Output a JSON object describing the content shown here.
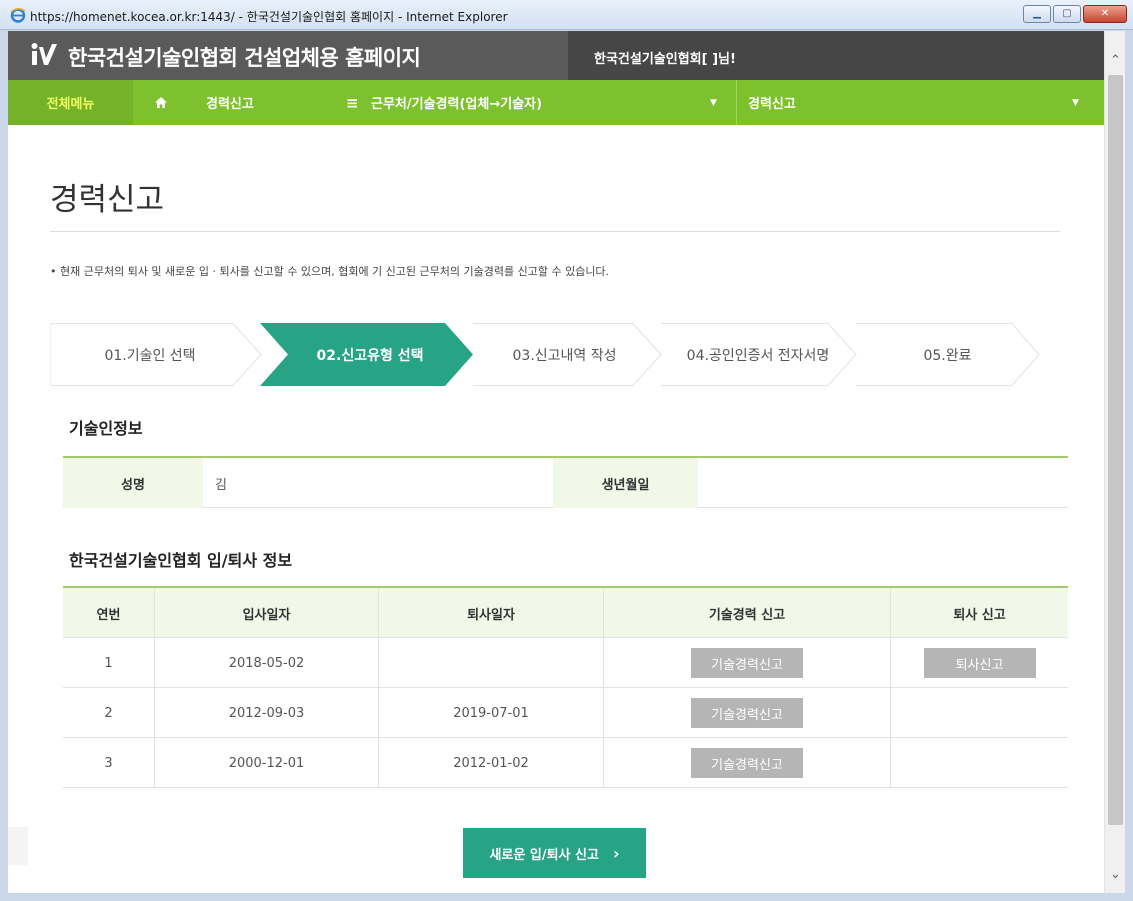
{
  "window": {
    "title": "https://homenet.kocea.or.kr:1443/ - 한국건설기술인협회 홈페이지 - Internet Explorer"
  },
  "header": {
    "site_title": "한국건설기술인협회 건설업체용 홈페이지",
    "user_greeting": "한국건설기술인협회[        ]님!"
  },
  "nav": {
    "all_menu": "전체메뉴",
    "section": "경력신고",
    "submenu": "근무처/기술경력(업체→기술자)",
    "current": "경력신고"
  },
  "page": {
    "title": "경력신고",
    "description": "• 현재 근무처의 퇴사 및 새로운 입 · 퇴사를 신고할 수 있으며, 협회에 기 신고된 근무처의 기술경력를 신고할 수 있습니다."
  },
  "steps": [
    {
      "label": "01.기술인 선택"
    },
    {
      "label": "02.신고유형 선택"
    },
    {
      "label": "03.신고내역 작성"
    },
    {
      "label": "04.공인인증서 전자서명"
    },
    {
      "label": "05.완료"
    }
  ],
  "tech_info": {
    "section_title": "기술인정보",
    "name_label": "성명",
    "name_value": "김",
    "birth_label": "생년월일",
    "birth_value": ""
  },
  "employment": {
    "section_title": "한국건설기술인협회 입/퇴사 정보",
    "columns": [
      "연번",
      "입사일자",
      "퇴사일자",
      "기술경력 신고",
      "퇴사 신고"
    ],
    "rows": [
      {
        "no": "1",
        "hire": "2018-05-02",
        "leave": "",
        "career_btn": "기술경력신고",
        "resign_btn": "퇴사신고"
      },
      {
        "no": "2",
        "hire": "2012-09-03",
        "leave": "2019-07-01",
        "career_btn": "기술경력신고",
        "resign_btn": ""
      },
      {
        "no": "3",
        "hire": "2000-12-01",
        "leave": "2012-01-02",
        "career_btn": "기술경력신고",
        "resign_btn": ""
      }
    ]
  },
  "cta": {
    "label": "새로운 입/퇴사 신고",
    "arrow": "›"
  },
  "colors": {
    "nav_green": "#7ec12f",
    "step_active": "#27a386",
    "header_gray": "#5a5a5a",
    "button_gray": "#b5b5b5"
  }
}
